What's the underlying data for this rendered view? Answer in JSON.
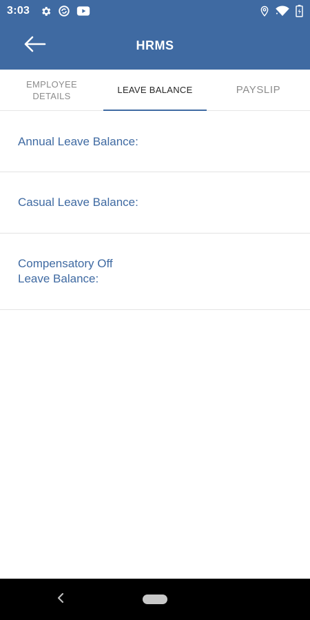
{
  "status_bar": {
    "time": "3:03",
    "left_icons": [
      "gear-icon",
      "sync-icon",
      "youtube-icon"
    ],
    "right_icons": [
      "location-icon",
      "wifi-icon",
      "battery-icon"
    ]
  },
  "app_bar": {
    "title": "HRMS",
    "back_icon": "arrow-left-icon",
    "color": "#3f6aa2"
  },
  "tabs": [
    {
      "label": "EMPLOYEE\nDETAILS",
      "active": false
    },
    {
      "label": "LEAVE BALANCE",
      "active": true
    },
    {
      "label": "PAYSLIP",
      "active": false
    }
  ],
  "leave_balances": [
    {
      "label": "Annual Leave Balance:",
      "value": ""
    },
    {
      "label": "Casual Leave Balance:",
      "value": ""
    },
    {
      "label": "Compensatory Off\nLeave Balance:",
      "value": ""
    }
  ],
  "nav_bar": {
    "back_icon": "chevron-left-icon",
    "home_icon": "home-pill-icon"
  },
  "colors": {
    "accent": "#3f6aa2",
    "text_label": "#3f6aa2",
    "tab_inactive": "#8c8c8c",
    "tab_active": "#262626"
  }
}
